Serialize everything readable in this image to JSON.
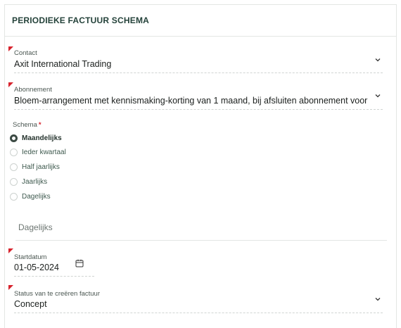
{
  "panel": {
    "title": "PERIODIEKE FACTUUR SCHEMA"
  },
  "contact": {
    "label": "Contact",
    "value": "Axit International Trading"
  },
  "abonnement": {
    "label": "Abonnement",
    "value": "Bloem-arrangement met kennismaking-korting van 1 maand, bij afsluiten abonnement voor"
  },
  "schema": {
    "label": "Schema",
    "required_mark": "*",
    "options": [
      {
        "label": "Maandelijks",
        "checked": true
      },
      {
        "label": "Ieder kwartaal",
        "checked": false
      },
      {
        "label": "Half jaarlijks",
        "checked": false
      },
      {
        "label": "Jaarlijks",
        "checked": false
      },
      {
        "label": "Dagelijks",
        "checked": false
      }
    ]
  },
  "frequency_field": {
    "value": "Dagelijks"
  },
  "startdatum": {
    "label": "Startdatum",
    "value": "01-05-2024",
    "icon": "calendar-icon"
  },
  "status": {
    "label": "Status van te creëren factuur",
    "value": "Concept"
  },
  "colors": {
    "accent": "#24423a",
    "required": "#d7222c"
  }
}
